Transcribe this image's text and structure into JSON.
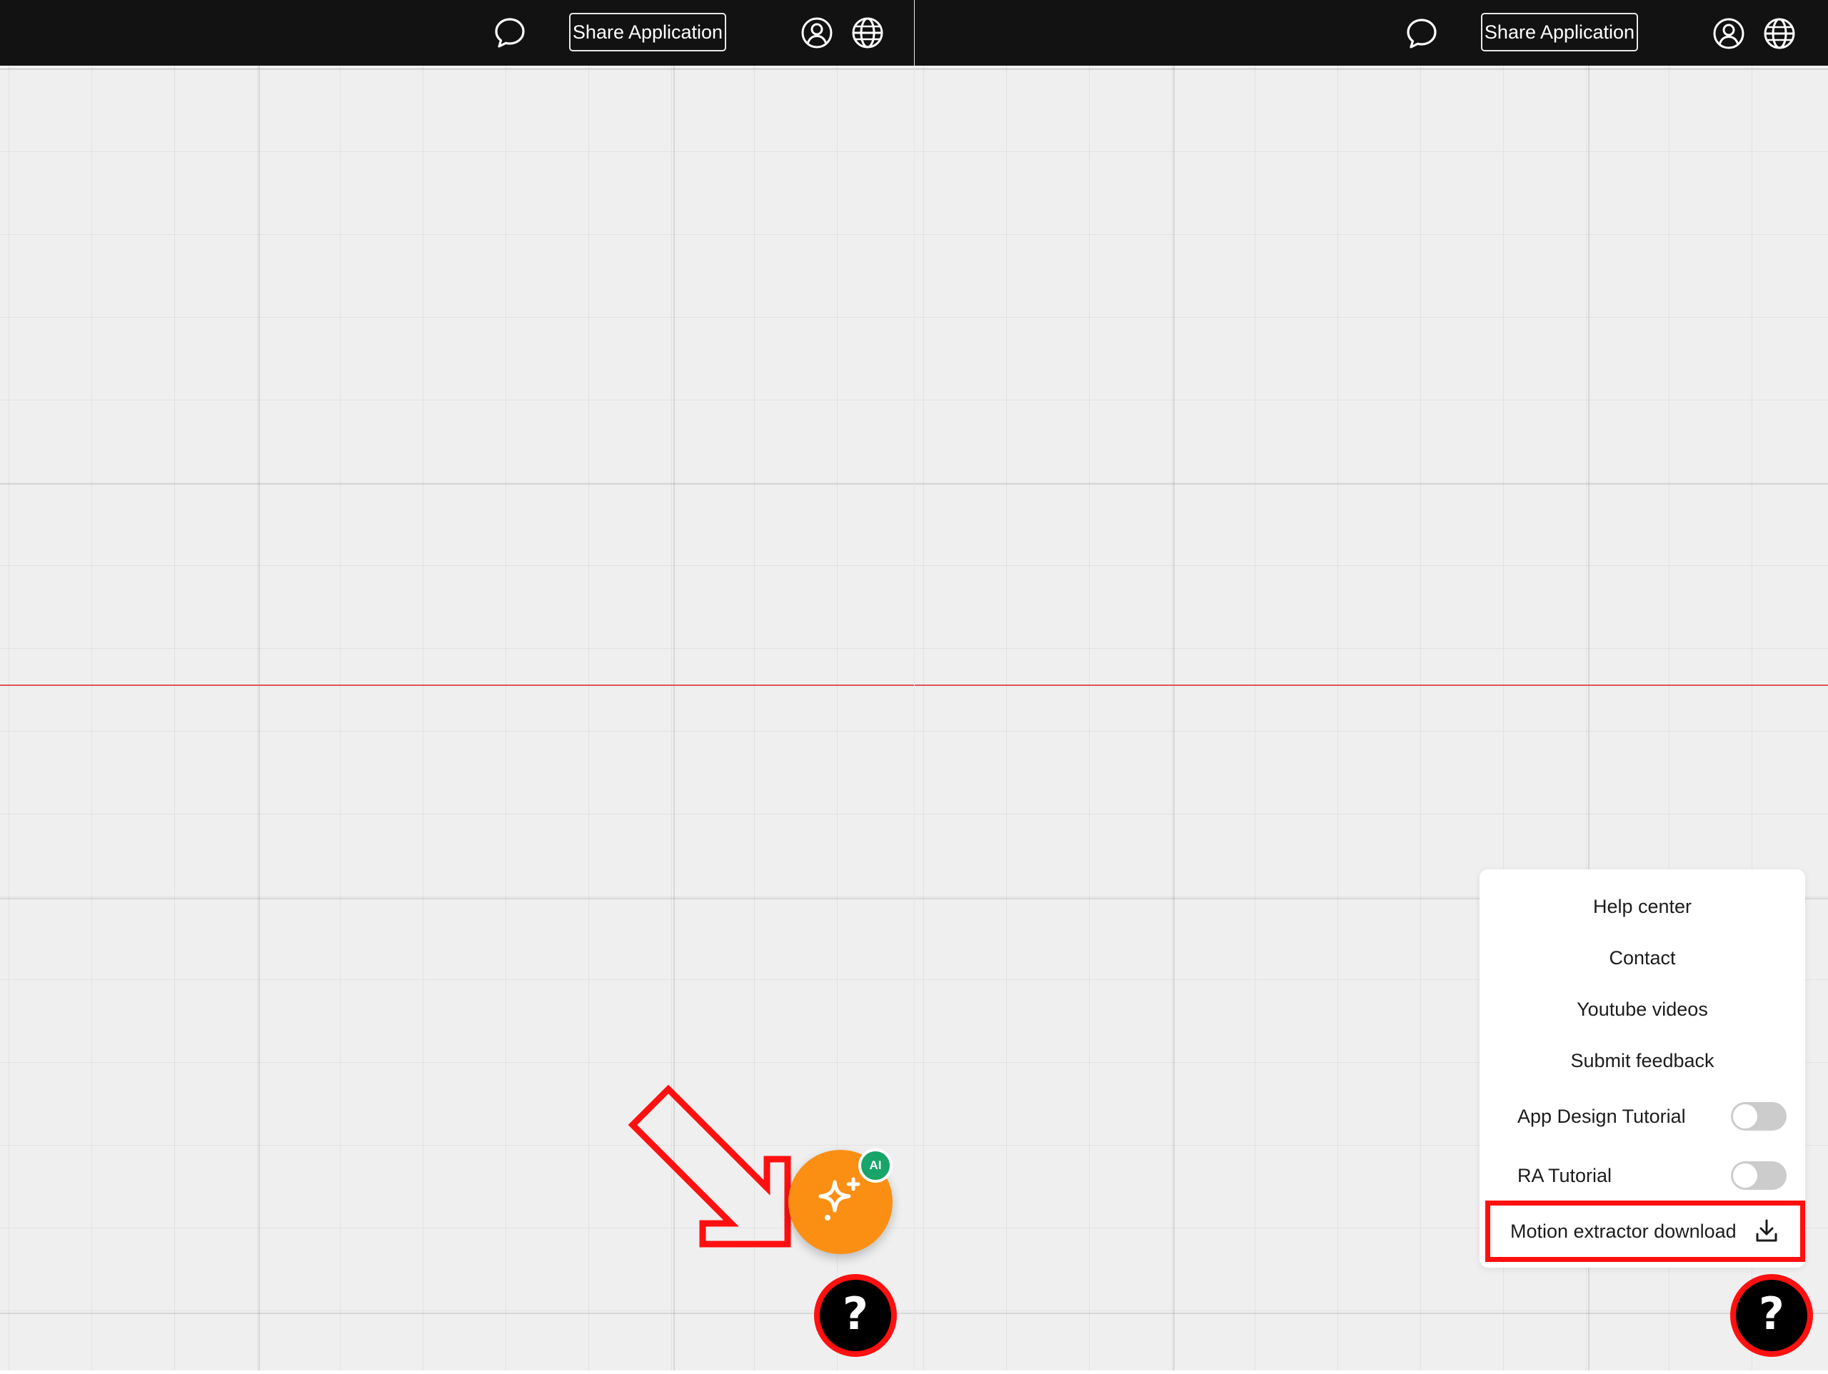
{
  "topbar": {
    "chat_icon": "chat-bubble-icon",
    "share_label": "Share Application",
    "account_icon": "user-account-icon",
    "language_icon": "globe-icon"
  },
  "left": {
    "ai_assistant": {
      "badge": "AI",
      "icon": "sparkles-icon"
    },
    "annotation_arrow": "arrow-icon",
    "help_label": "?"
  },
  "right": {
    "help_menu": {
      "items": [
        "Help center",
        "Contact",
        "Youtube videos",
        "Submit feedback"
      ],
      "toggles": [
        {
          "label": "App Design Tutorial",
          "on": false
        },
        {
          "label": "RA Tutorial",
          "on": false
        }
      ],
      "download": {
        "label": "Motion extractor download",
        "icon": "download-icon"
      }
    },
    "help_label": "?"
  },
  "colors": {
    "topbar": "#121212",
    "canvas": "#efefef",
    "ai_button": "#fb8f14",
    "ai_badge": "#19a46a",
    "highlight": "#ff1010"
  }
}
